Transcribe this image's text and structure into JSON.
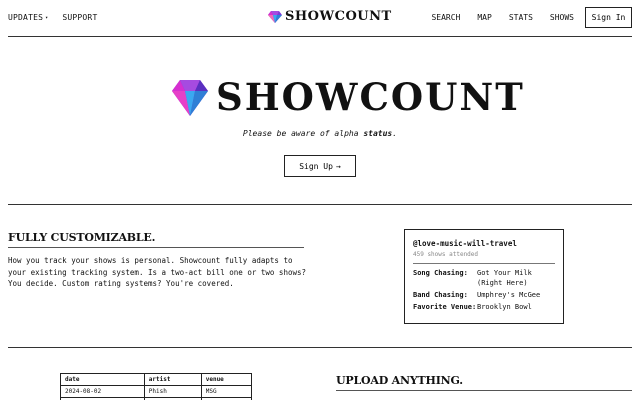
{
  "nav": {
    "left": [
      {
        "label": "UPDATES",
        "has_dropdown": true
      },
      {
        "label": "SUPPORT",
        "has_dropdown": false
      }
    ],
    "brand": {
      "name": "SHOWCOUNT"
    },
    "right": [
      "SEARCH",
      "MAP",
      "STATS",
      "SHOWS"
    ],
    "signin_label": "Sign In"
  },
  "hero": {
    "title": "SHOWCOUNT",
    "alpha_prefix": "Please be aware of alpha ",
    "alpha_status": "status",
    "alpha_suffix": ".",
    "signup_label": "Sign Up",
    "signup_arrow": "→"
  },
  "feature_customizable": {
    "title": "FULLY CUSTOMIZABLE.",
    "body": "How you track your shows is personal. Showcount fully adapts to your existing tracking system. Is a two-act bill one or two shows? You decide. Custom rating systems? You're covered."
  },
  "profile_card": {
    "handle": "@love-music-will-travel",
    "shows_attended": "459 shows attended",
    "rows": [
      {
        "key": "Song Chasing:",
        "value": "Got Your Milk (Right Here)"
      },
      {
        "key": "Band Chasing:",
        "value": "Umphrey's McGee"
      },
      {
        "key": "Favorite Venue:",
        "value": "Brooklyn Bowl"
      }
    ]
  },
  "shows_table": {
    "headers": [
      "date",
      "artist",
      "venue"
    ],
    "rows": [
      [
        "2024-08-02",
        "Phish",
        "MSG"
      ]
    ]
  },
  "feature_upload": {
    "title": "UPLOAD ANYTHING."
  },
  "colors": {
    "logo_magenta": "#d62fd0",
    "logo_purple": "#7a3bd6",
    "logo_blue": "#3aa8f0",
    "logo_pink": "#f06ab8",
    "rule": "#333333"
  },
  "icons": {
    "logo": "showcount-gem-icon",
    "dropdown": "caret-down-icon",
    "arrow": "arrow-right-icon"
  }
}
